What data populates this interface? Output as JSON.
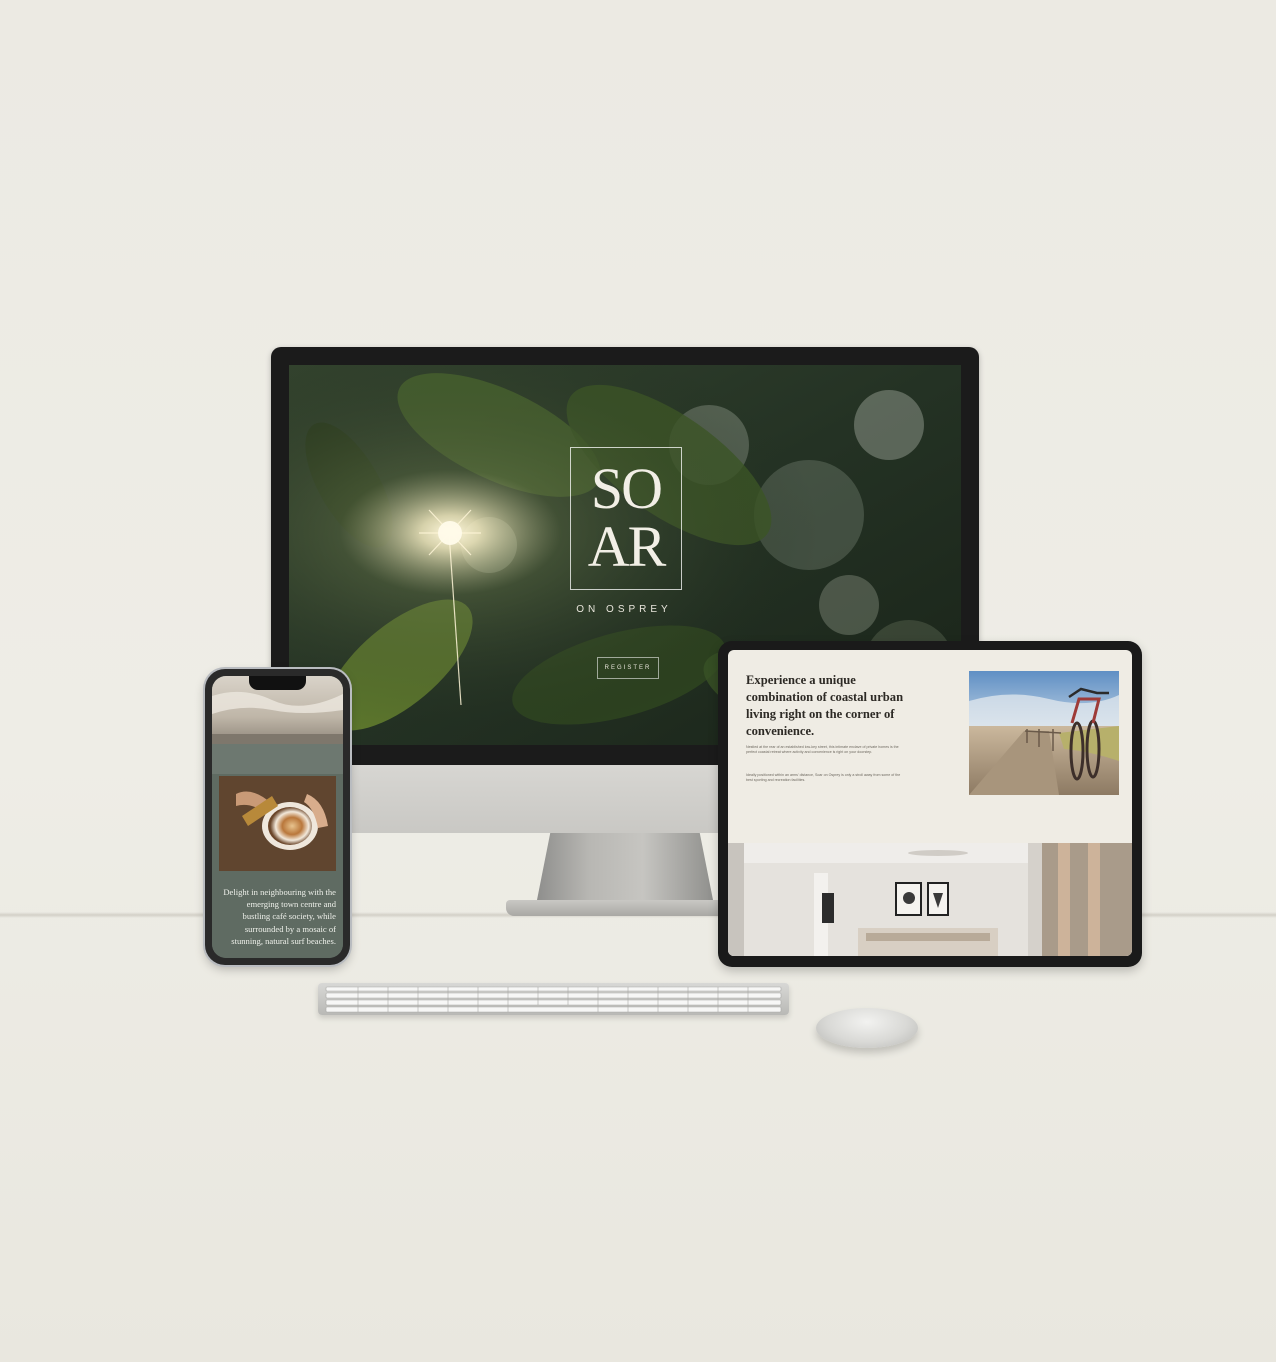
{
  "monitor_site": {
    "logo_line1": "SO",
    "logo_line2": "AR",
    "logo_subtitle": "ON OSPREY",
    "register_label": "REGISTER"
  },
  "phone_site": {
    "paragraph": "Delight in neighbouring with the emerging town centre and bustling café society, while surrounded by a mosaic of stunning, natural surf beaches."
  },
  "tablet_site": {
    "heading": "Experience a unique combination of coastal urban living right on the corner of convenience.",
    "paragraph1": "Nestled at the rear of an established low-key street, this intimate enclave of private homes is the perfect coastal retreat where activity and convenience is right on your doorstep.",
    "paragraph2": "Ideally positioned within an arms' distance, Soar on Osprey is only a stroll away from some of the best sporting and recreation facilities."
  },
  "colors": {
    "background": "#edebe4",
    "phone_panel": "#5f6b62",
    "tablet_panel": "#efece4",
    "heading_text": "#2d2a25"
  }
}
